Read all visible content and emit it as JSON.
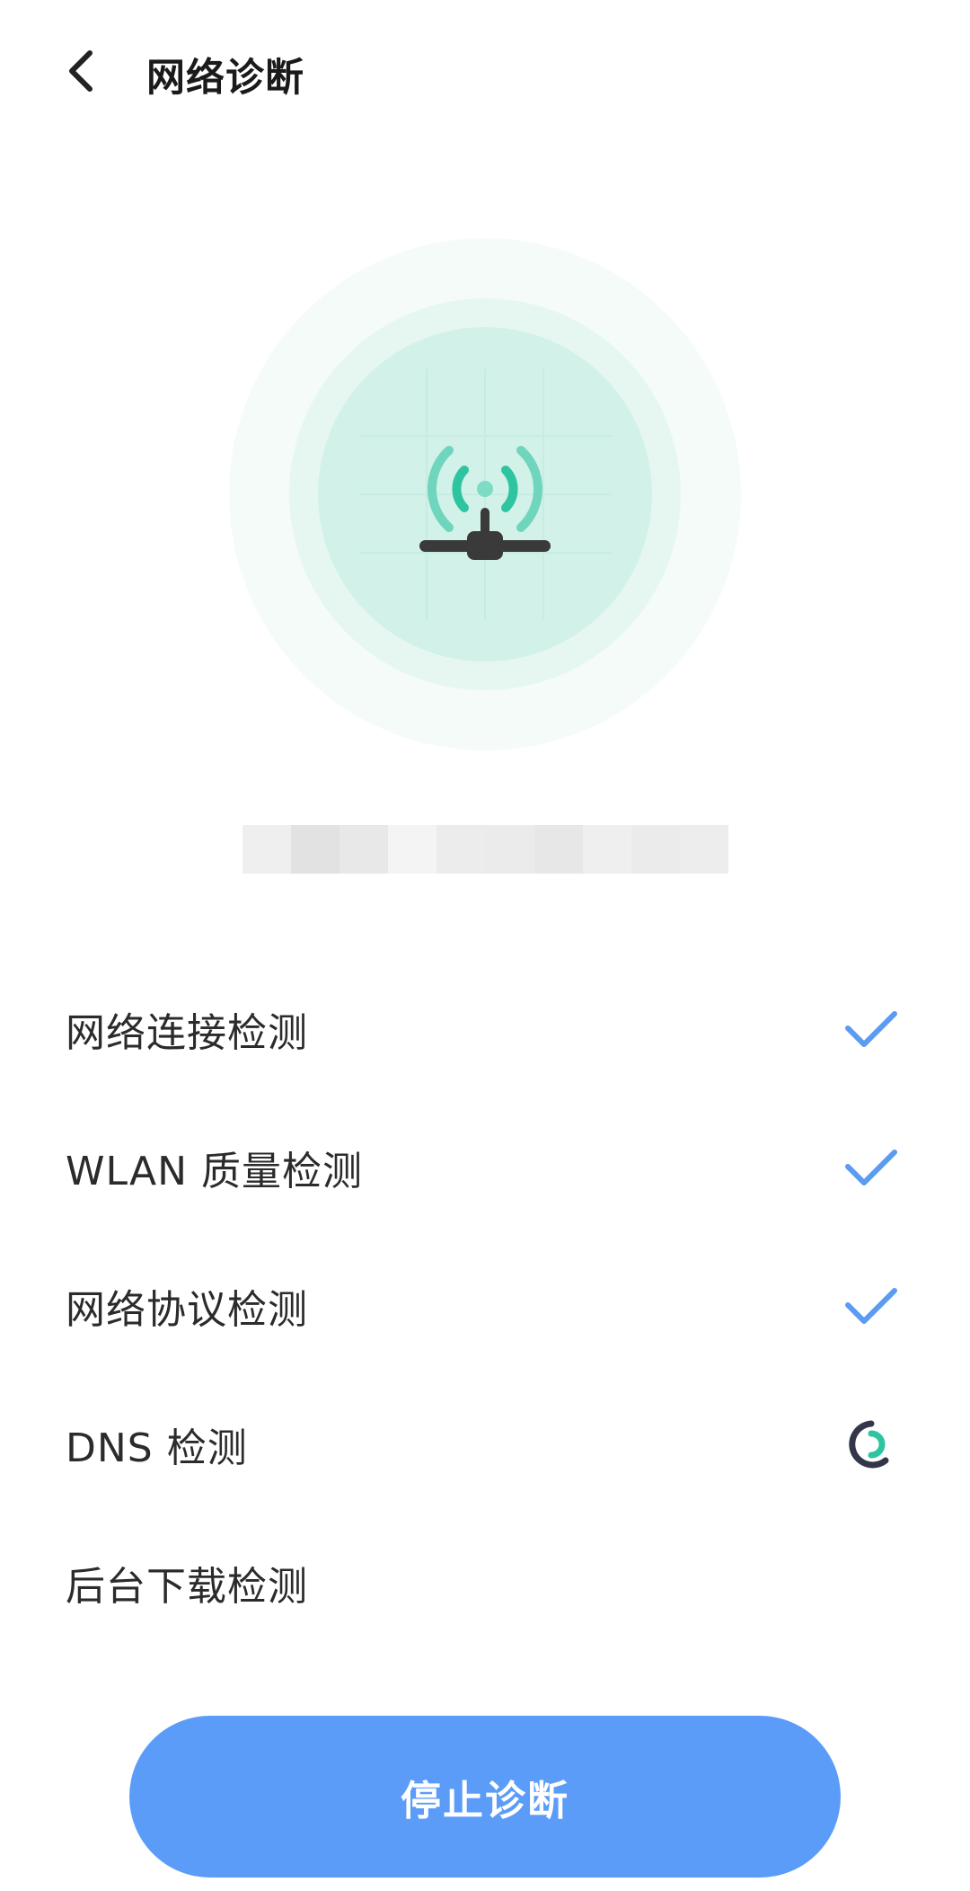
{
  "header": {
    "title": "网络诊断",
    "back_icon": "chevron-left-icon"
  },
  "hero": {
    "icon": "wifi-router-icon",
    "accent_color": "#2ec4a0",
    "ring_colors": [
      "#f4fbf9",
      "#e6f7f2",
      "#d2f1e8"
    ]
  },
  "network_name": {
    "masked": true,
    "value": ""
  },
  "checks": [
    {
      "label": "网络连接检测",
      "status": "done",
      "status_icon": "checkmark-icon"
    },
    {
      "label": "WLAN 质量检测",
      "status": "done",
      "status_icon": "checkmark-icon"
    },
    {
      "label": "网络协议检测",
      "status": "done",
      "status_icon": "checkmark-icon"
    },
    {
      "label": "DNS 检测",
      "status": "in-progress",
      "status_icon": "loading-spinner-icon"
    },
    {
      "label": "后台下载检测",
      "status": "pending",
      "status_icon": ""
    }
  ],
  "colors": {
    "check_blue": "#5b9bf0",
    "button_blue": "#5a9cf8",
    "spinner_dark": "#33364a",
    "spinner_green": "#2ec4a0"
  },
  "stop_button": {
    "label": "停止诊断"
  }
}
